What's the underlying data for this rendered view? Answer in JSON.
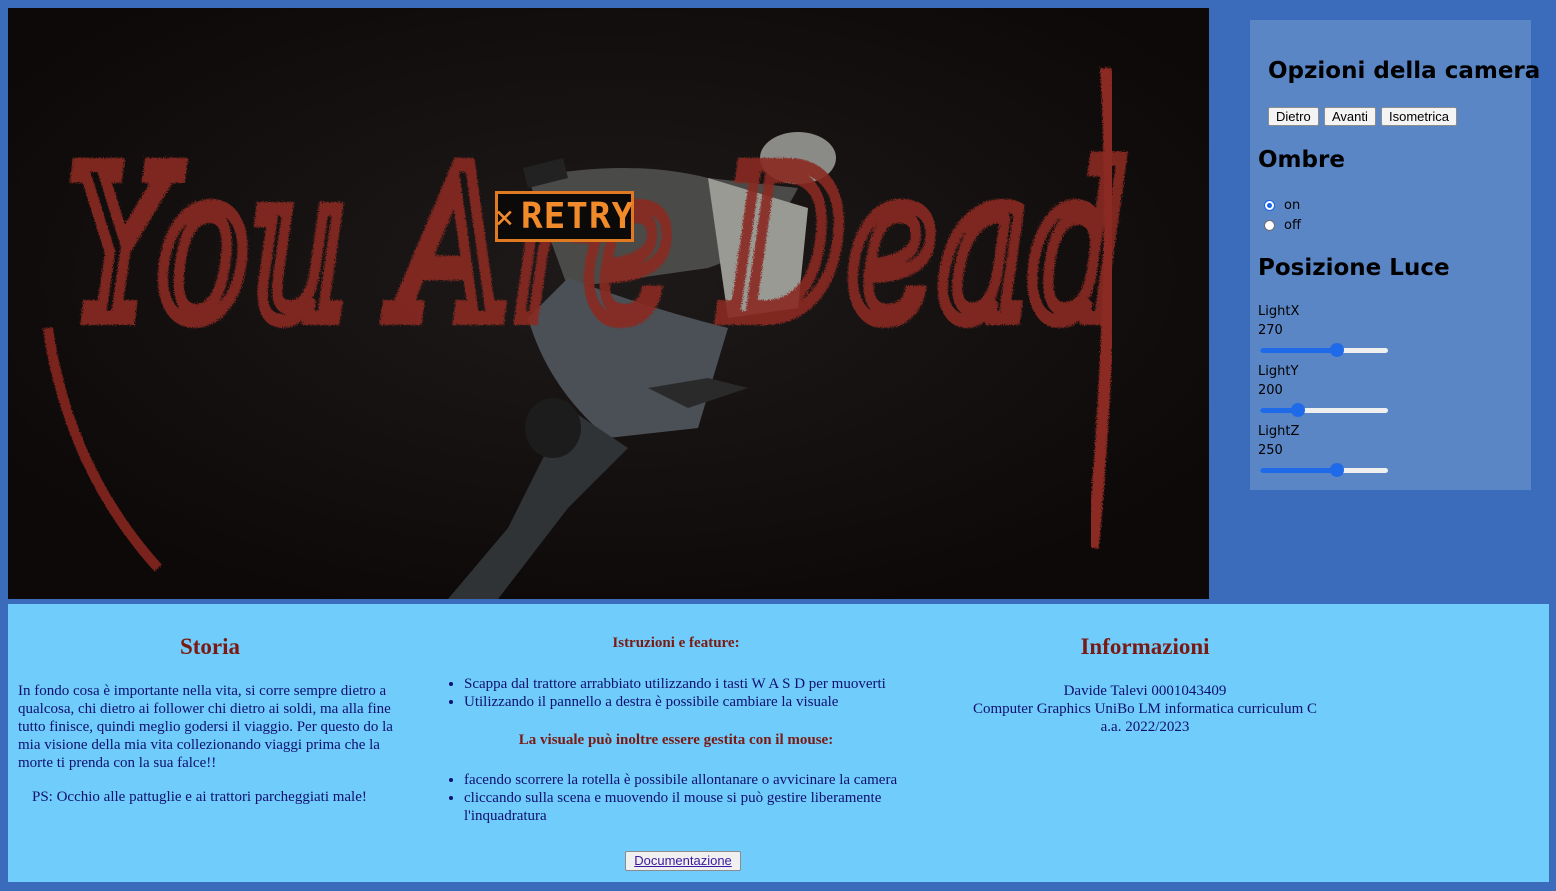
{
  "game": {
    "overlay_text": "You Are Dead",
    "retry_icon": "×",
    "retry_label": "RETRY",
    "accent_color": "#e07a22"
  },
  "panel": {
    "camera_title": "Opzioni della camera",
    "camera_buttons": [
      "Dietro",
      "Avanti",
      "Isometrica"
    ],
    "shadows_title": "Ombre",
    "shadow_options": [
      {
        "label": "on",
        "checked": true
      },
      {
        "label": "off",
        "checked": false
      }
    ],
    "light_title": "Posizione Luce",
    "lights": [
      {
        "label": "LightX",
        "value": "270",
        "fraction": 0.6
      },
      {
        "label": "LightY",
        "value": "200",
        "fraction": 0.3
      },
      {
        "label": "LightZ",
        "value": "250",
        "fraction": 0.6
      }
    ]
  },
  "footer": {
    "story": {
      "title": "Storia",
      "text": "In fondo cosa è importante nella vita, si corre sempre dietro a qualcosa, chi dietro ai follower chi dietro ai soldi, ma alla fine tutto finisce, quindi meglio godersi il viaggio. Per questo do la mia visione della mia vita collezionando viaggi prima che la morte ti prenda con la sua falce!!",
      "ps": "PS: Occhio alle pattuglie e ai trattori parcheggiati male!"
    },
    "instructions": {
      "title": "Istruzioni e feature:",
      "items": [
        "Scappa dal trattore arrabbiato utilizzando i tasti W A S D per muoverti",
        "Utilizzando il pannello a destra è possibile cambiare la visuale"
      ],
      "mouse_title": "La visuale può inoltre essere gestita con il mouse:",
      "mouse_items": [
        "facendo scorrere la rotella è possibile allontanare o avvicinare la camera",
        "cliccando sulla scena e muovendo il mouse si può gestire liberamente l'inquadratura"
      ],
      "doc_button": "Documentazione"
    },
    "info": {
      "title": "Informazioni",
      "lines": [
        "Davide Talevi 0001043409",
        "Computer Graphics UniBo LM informatica curriculum C",
        "a.a. 2022/2023"
      ]
    }
  }
}
